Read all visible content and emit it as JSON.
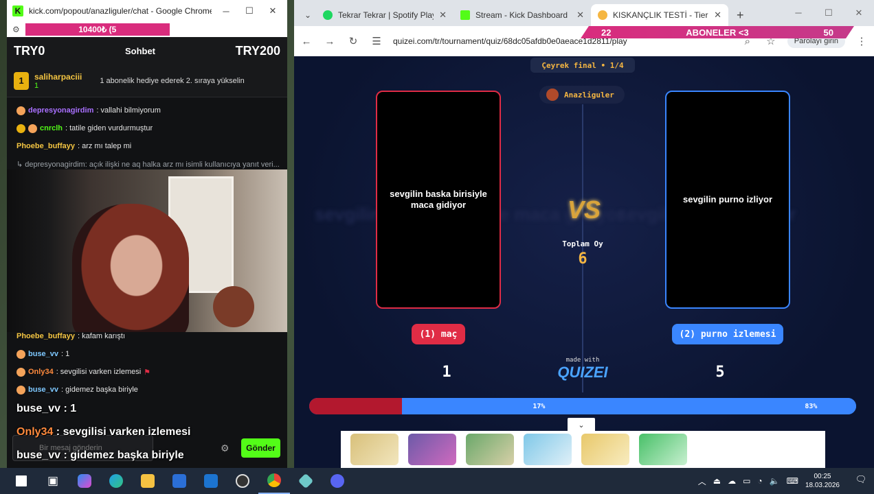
{
  "popout": {
    "window_title": "kick.com/popout/anazliguler/chat - Google Chrome",
    "goal_overlay_text": "10400₺ (5",
    "currency_left": "TRY0",
    "sohbet": "Sohbet",
    "currency_right": "TRY200",
    "pinned": {
      "rank": "1",
      "username": "saliharpaciii",
      "sub_count": "1",
      "gift_text": "1 abonelik hediye ederek 2. sıraya yükselin"
    },
    "messages_top": [
      {
        "user": "depresyonagirdim",
        "text": ": vallahi bilmiyorum",
        "color": "#a970ff"
      },
      {
        "user": "cnrclh",
        "text": ": tatile giden vurdurmuştur",
        "color": "#53fc18"
      },
      {
        "user": "Phoebe_buffayy",
        "text": ": arz mı talep mi",
        "color": "#f4c542"
      },
      {
        "user": "",
        "text": "↳ depresyonagirdim: açık ilişki ne aq halka arz mı isimli kullanıcıya yanıt veri...",
        "color": "#9aa0a6"
      }
    ],
    "messages_bottom": [
      {
        "user": "Phoebe_buffayy",
        "text": ": kafam karıştı",
        "color": "#f4c542"
      },
      {
        "user": "buse_vv",
        "text": ": 1",
        "color": "#7ec8ff"
      },
      {
        "user": "Only34",
        "text": ": sevgilisi varken izlemesi",
        "color": "#ff8a3d"
      },
      {
        "user": "buse_vv",
        "text": ": gidemez başka biriyle",
        "color": "#7ec8ff"
      }
    ],
    "overlay": [
      {
        "user": "buse_vv",
        "text": " : 1"
      },
      {
        "user": "Only34",
        "text": " : sevgilisi varken izlemesi"
      },
      {
        "user": "buse_vv",
        "text": " : gidemez başka biriyle"
      }
    ],
    "input_placeholder": "Bir mesaj gönderin",
    "send_label": "Gönder"
  },
  "browser": {
    "tabs": [
      {
        "title": "Tekrar Tekrar | Spotify Playl",
        "color": "#1ed760"
      },
      {
        "title": "Stream - Kick Dashboard",
        "color": "#53fc18"
      },
      {
        "title": "KISKANÇLIK TESTİ - Tier Lis",
        "color": "#f5b642"
      }
    ],
    "url": "quizei.com/tr/tournament/quiz/68dc05afdb0e0aeace1d2811/play",
    "password_chip": "Parolayı girin",
    "sub_goal": {
      "left": "22",
      "title": "ABONELER <3",
      "right": "50"
    }
  },
  "quiz": {
    "stage": "Çeyrek final • 1/4",
    "creator": "Anazliguler",
    "left_text": "sevgilin baska birisiyle maca gidiyor",
    "right_text": "sevgilin purno izliyor",
    "vs": "VS",
    "total_label": "Toplam Oy",
    "total_votes": "6",
    "left_choice": "(1) maç",
    "right_choice": "(2) purno izlemesi",
    "made_with": "made with",
    "brand": "QUIZEI",
    "left_votes": "1",
    "right_votes": "5",
    "left_pct_label": "17%",
    "right_pct_label": "83%",
    "left_pct": 17,
    "right_pct": 83
  },
  "taskbar": {
    "time": "00:25",
    "date": "18.03.2026"
  }
}
